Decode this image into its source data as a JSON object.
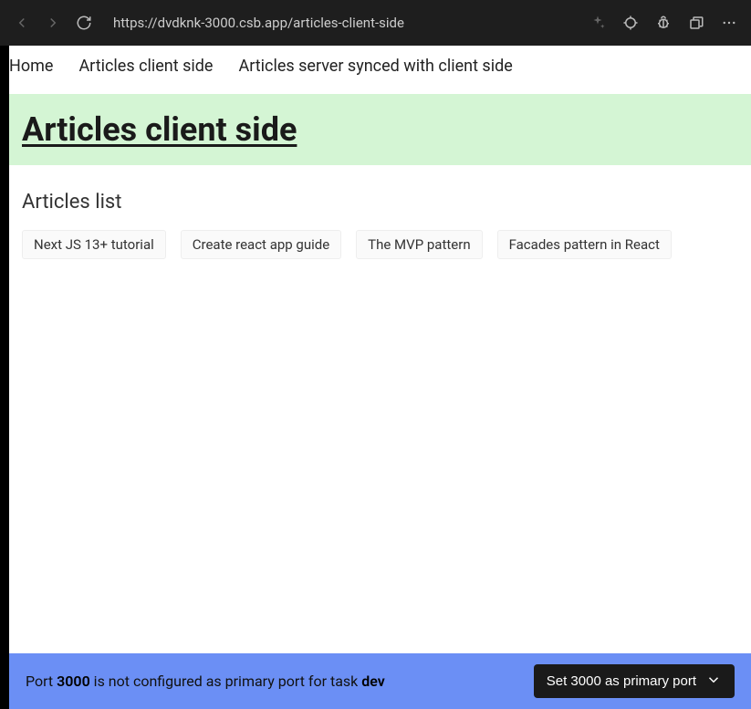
{
  "browser": {
    "url": "https://dvdknk-3000.csb.app/articles-client-side"
  },
  "nav": {
    "items": [
      {
        "label": "Home"
      },
      {
        "label": "Articles client side"
      },
      {
        "label": "Articles server synced with client side"
      }
    ]
  },
  "page": {
    "title": "Articles client side"
  },
  "content": {
    "heading": "Articles list",
    "articles": [
      {
        "title": "Next JS 13+ tutorial"
      },
      {
        "title": "Create react app guide"
      },
      {
        "title": "The MVP pattern"
      },
      {
        "title": "Facades pattern in React"
      }
    ]
  },
  "port_banner": {
    "prefix": "Port ",
    "port": "3000",
    "middle": " is not configured as primary port for task ",
    "task": "dev",
    "button_label": "Set 3000 as primary port"
  }
}
